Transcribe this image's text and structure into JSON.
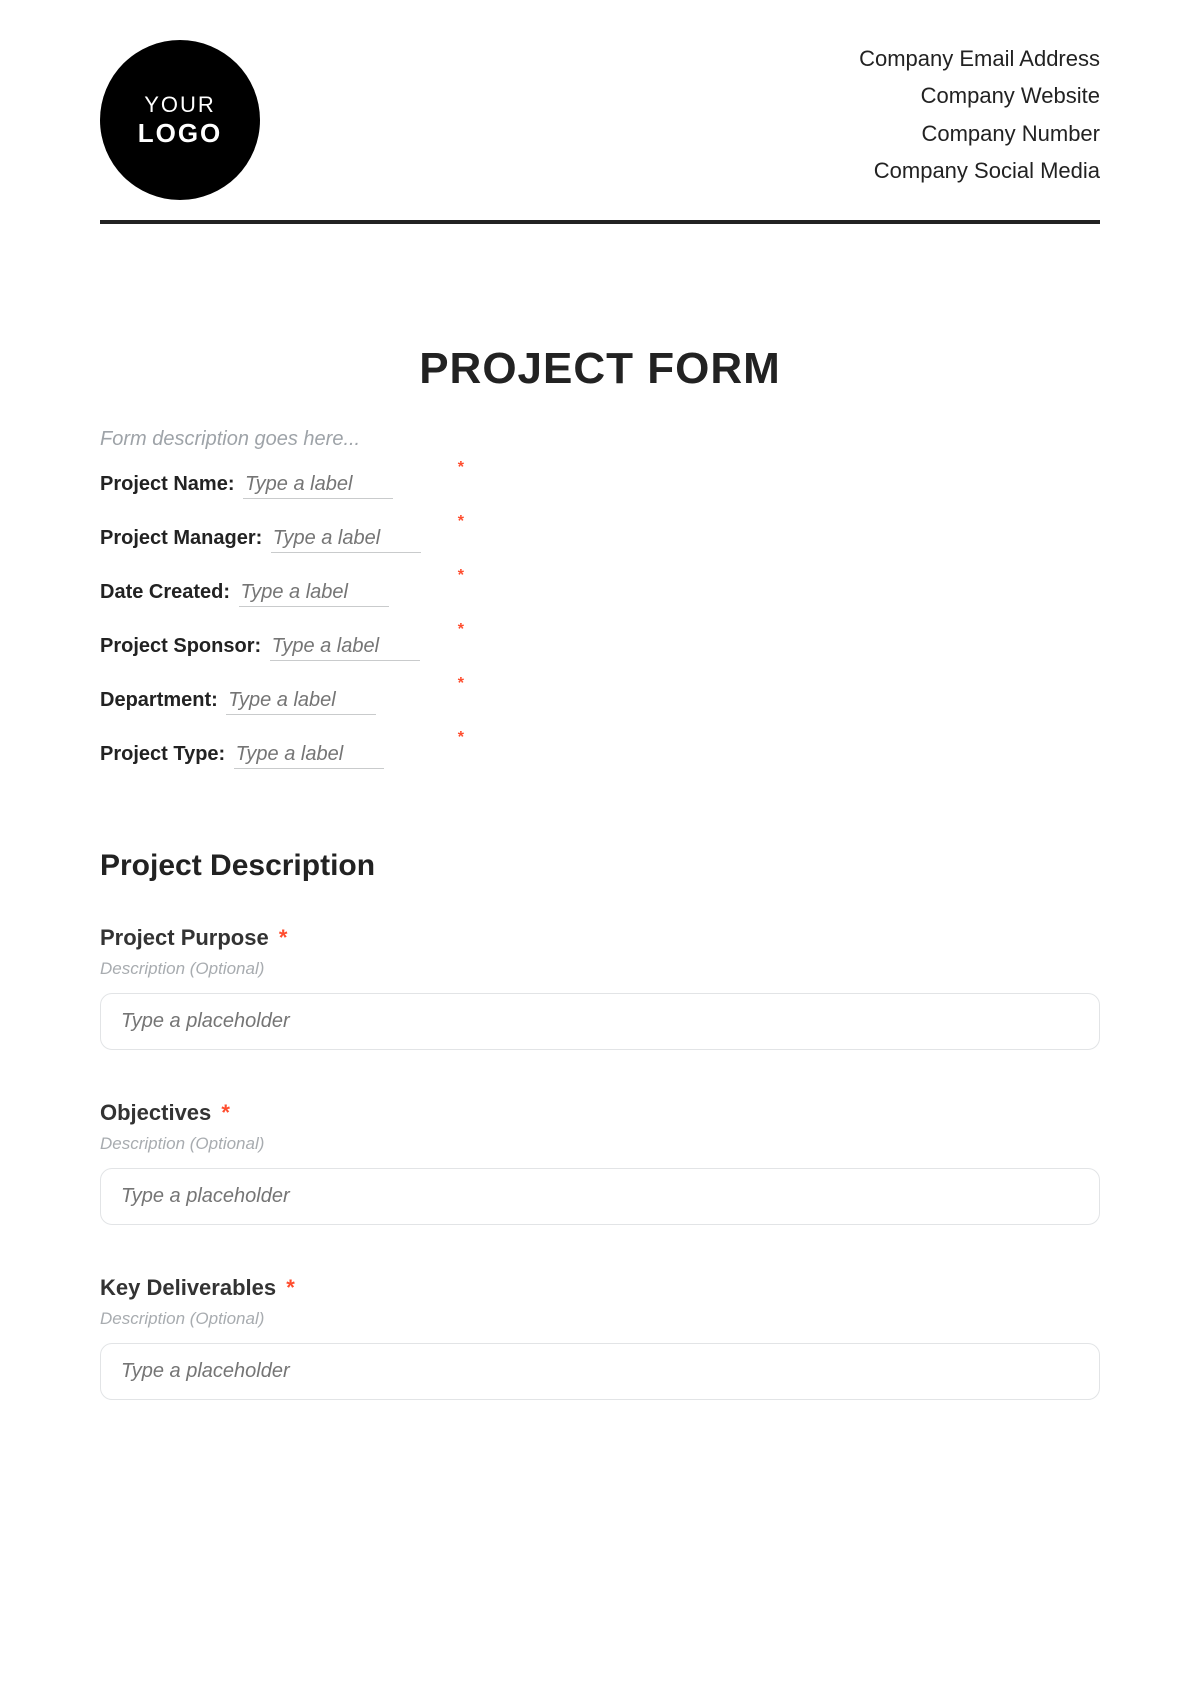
{
  "header": {
    "logo_top": "YOUR",
    "logo_bottom": "LOGO",
    "company_lines": [
      "Company Email Address",
      "Company Website",
      "Company Number",
      "Company Social Media"
    ]
  },
  "title": "PROJECT FORM",
  "form_description_placeholder": "Form description goes here...",
  "fields": [
    {
      "label": "Project Name:",
      "placeholder": "Type a label",
      "required": true
    },
    {
      "label": "Project Manager:",
      "placeholder": "Type a label",
      "required": true
    },
    {
      "label": "Date Created:",
      "placeholder": "Type a label",
      "required": true
    },
    {
      "label": "Project Sponsor:",
      "placeholder": "Type a label",
      "required": true
    },
    {
      "label": "Department:",
      "placeholder": "Type a label",
      "required": true
    },
    {
      "label": "Project Type:",
      "placeholder": "Type a label",
      "required": true
    }
  ],
  "section": {
    "heading": "Project Description",
    "subfields": [
      {
        "label": "Project Purpose",
        "required": true,
        "description": "Description (Optional)",
        "placeholder": "Type a placeholder"
      },
      {
        "label": "Objectives",
        "required": true,
        "description": "Description (Optional)",
        "placeholder": "Type a placeholder"
      },
      {
        "label": "Key Deliverables",
        "required": true,
        "description": "Description (Optional)",
        "placeholder": "Type a placeholder"
      }
    ]
  },
  "required_mark": "*"
}
